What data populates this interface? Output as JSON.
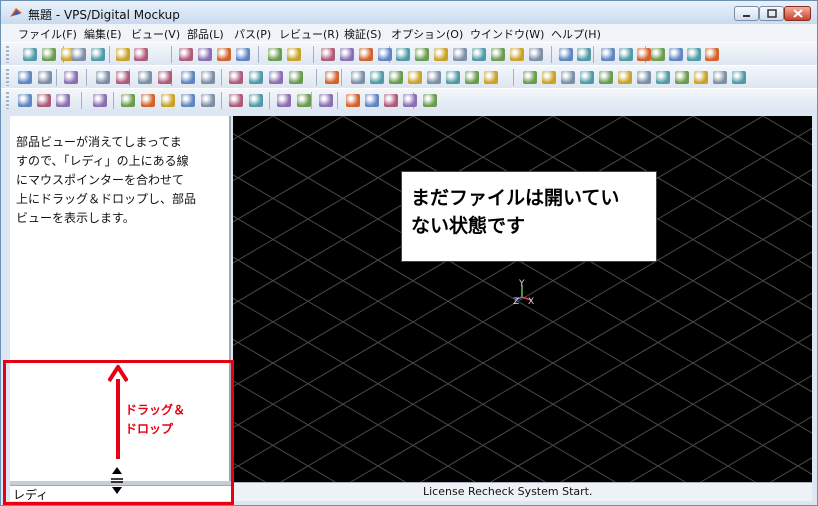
{
  "window": {
    "title": "無題 - VPS/Digital Mockup",
    "controls": [
      "minimize",
      "maximize",
      "close"
    ]
  },
  "menu": [
    "ファイル(F)",
    "編集(E)",
    "ビュー(V)",
    "部品(L)",
    "パス(P)",
    "レビュー(R)",
    "検証(S)",
    "オプション(O)",
    "ウインドウ(W)",
    "ヘルプ(H)"
  ],
  "parts_view": {
    "note_lines": [
      "部品ビューが消えてしまってま",
      "すので、「レディ」の上にある線",
      "にマウスポインターを合わせて",
      "上にドラッグ＆ドロップし、部品",
      "ビューを表示します。"
    ],
    "tab_label": "レディ"
  },
  "viewport": {
    "callout_lines": [
      "まだファイルは開いてい",
      "ない状態です"
    ],
    "axis_labels": {
      "y": "Y",
      "z": "Z",
      "x": "X"
    }
  },
  "annotation": {
    "drag_drop_lines": [
      "ドラッグ＆",
      "ドロップ"
    ],
    "color": "#e60012"
  },
  "status": {
    "message": "License Recheck System Start."
  },
  "colors": {
    "viewport_bg": "#000000",
    "grid": "#4a4a4a",
    "highlight_red": "#e60012"
  }
}
